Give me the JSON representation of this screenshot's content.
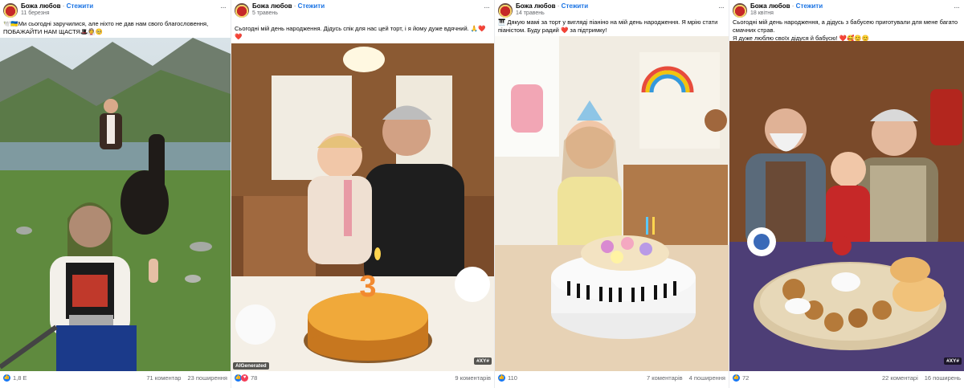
{
  "posts": [
    {
      "author": "Божа любов",
      "sep": "·",
      "follow": "Стежити",
      "date": "11 березня",
      "more": "···",
      "caption": "🕊️🇺🇦Ми сьогодні заручилися, але ніхто не дав нам свого благословення, ПОБАЖАЙТИ НАМ ЩАСТЯ🎩👰🥺",
      "reactions": "1,8 E",
      "comments": "71 коментар",
      "shares": "23 поширення",
      "image_alt": "couple-mountains-horse"
    },
    {
      "author": "Божа любов",
      "sep": "·",
      "follow": "Стежити",
      "date": "5 травень",
      "more": "···",
      "caption": "Сьогодні мій день народження. Дідусь спік для нас цей торт, і я йому дуже вдячний. 🙏❤️❤️",
      "reactions": "78",
      "comments": "9 коментарів",
      "shares": "",
      "badge_ai": "AIGenerated",
      "badge_xy": "#XY#",
      "candle_number": "3"
    },
    {
      "author": "Божа любов",
      "sep": "·",
      "follow": "Стежити",
      "date": "14 травень",
      "more": "···",
      "caption": "🎹 Дякую мамі за торт у вигляді піаніно на мій день народження. Я мрію стати піаністом. Буду радий ❤️ за підтримку!",
      "reactions": "110",
      "comments": "7 коментарів",
      "shares": "4 поширення"
    },
    {
      "author": "Божа любов",
      "sep": "·",
      "follow": "Стежити",
      "date": "18 квітня",
      "more": "···",
      "caption": "Сьогодні мій день народження, а дідусь з бабусею приготували для мене багато смачних страв.\nЯ дуже люблю своїх дідуся й бабусю! ❤️🥰😊😊",
      "reactions": "72",
      "comments": "22 коментарі",
      "shares": "16 поширень",
      "badge_xy": "#XY#"
    }
  ],
  "colors": {
    "accent": "#1b74e4",
    "like": "#1877f2",
    "love": "#f33e58"
  }
}
